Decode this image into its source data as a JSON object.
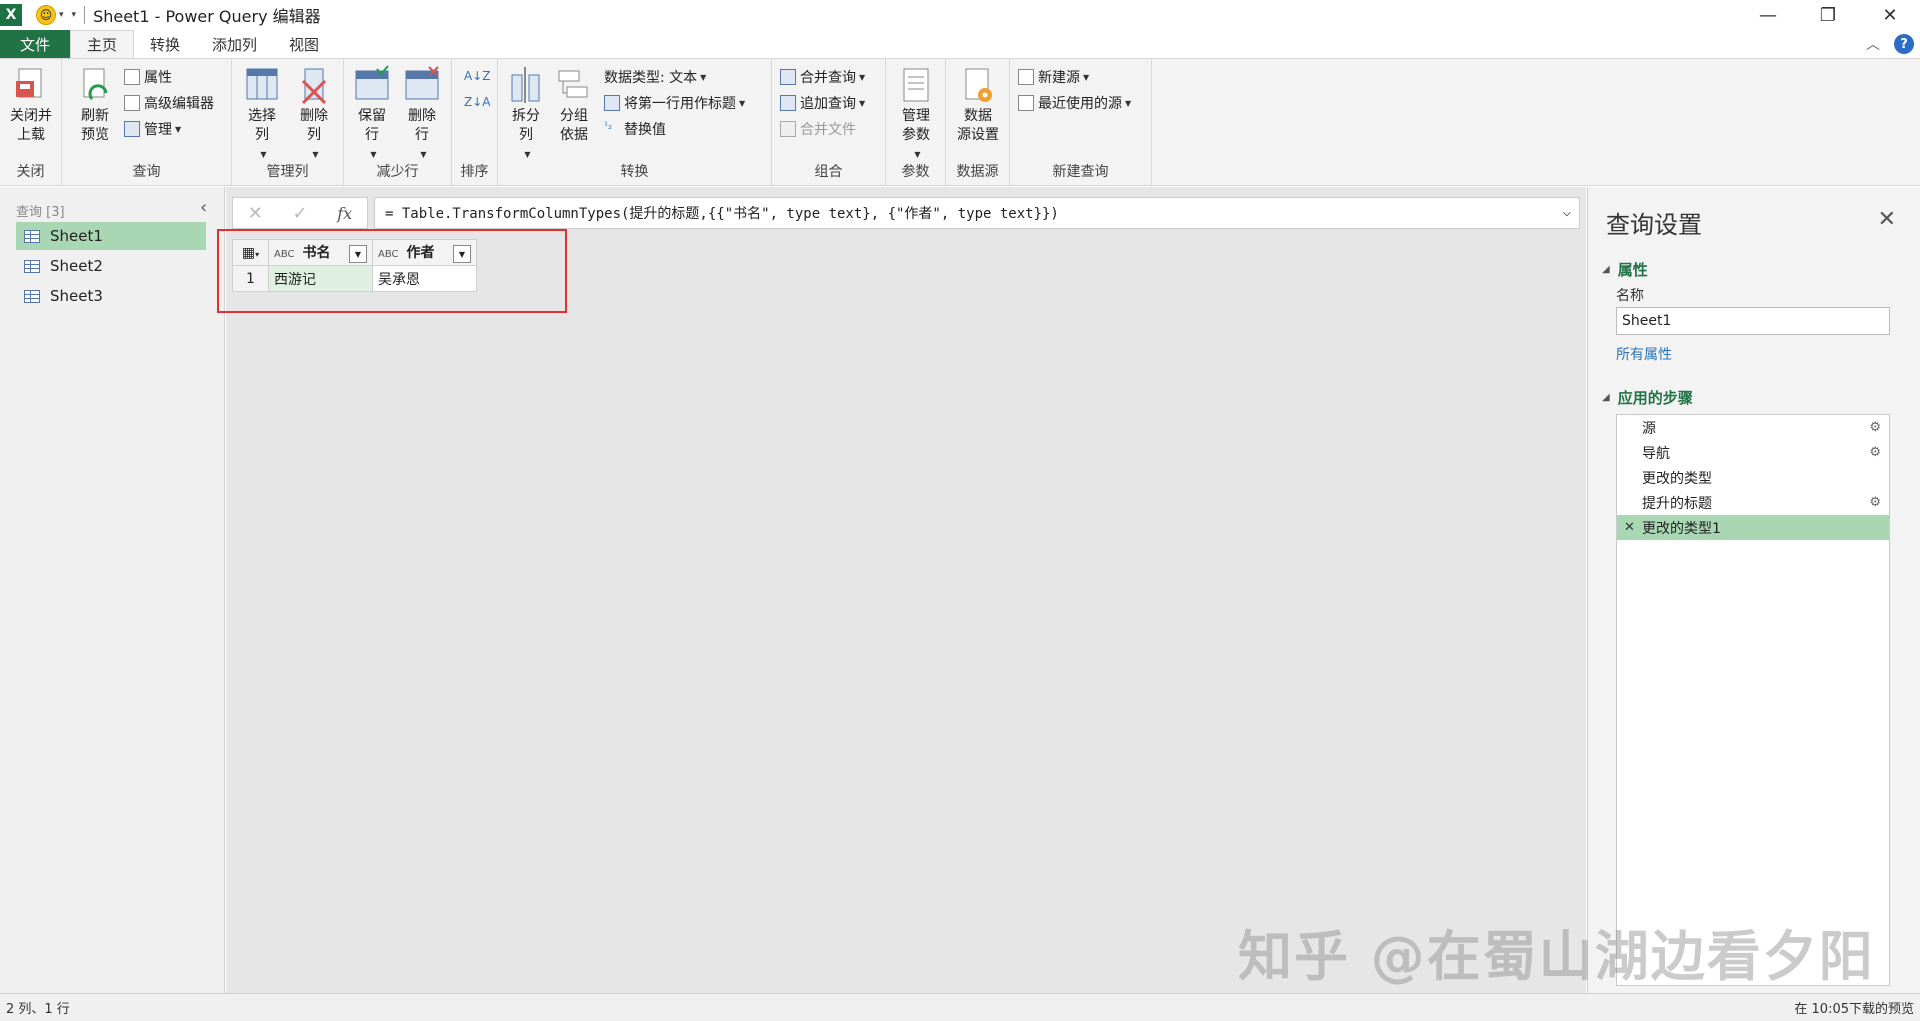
{
  "title": {
    "app_icon": "X",
    "text": "Sheet1 - Power Query 编辑器"
  },
  "tabs": [
    "文件",
    "主页",
    "转换",
    "添加列",
    "视图"
  ],
  "ribbon": {
    "close_load": "关闭并\n上载",
    "close_group": "关闭",
    "refresh": "刷新\n预览",
    "properties": "属性",
    "advanced_editor": "高级编辑器",
    "manage": "管理",
    "query_group": "查询",
    "choose_cols": "选择\n列",
    "remove_cols": "删除\n列",
    "manage_cols_group": "管理列",
    "keep_rows": "保留\n行",
    "remove_rows": "删除\n行",
    "reduce_rows_group": "减少行",
    "sort_group": "排序",
    "split_col": "拆分\n列",
    "group_by": "分组\n依据",
    "data_type": "数据类型: 文本",
    "first_row_header": "将第一行用作标题",
    "replace_values": "替换值",
    "transform_group": "转换",
    "merge_queries": "合并查询",
    "append_queries": "追加查询",
    "combine_files": "合并文件",
    "combine_group": "组合",
    "manage_params": "管理\n参数",
    "params_group": "参数",
    "data_source_settings": "数据\n源设置",
    "data_source_group": "数据源",
    "new_source": "新建源",
    "recent_sources": "最近使用的源",
    "new_query_group": "新建查询"
  },
  "queries": {
    "header": "查询 [3]",
    "items": [
      "Sheet1",
      "Sheet2",
      "Sheet3"
    ]
  },
  "formula": "= Table.TransformColumnTypes(提升的标题,{{\"书名\", type text}, {\"作者\", type text}})",
  "grid": {
    "type_icon": "ABC",
    "columns": [
      "书名",
      "作者"
    ],
    "rows": [
      {
        "num": "1",
        "cells": [
          "西游记",
          "吴承恩"
        ]
      }
    ]
  },
  "settings": {
    "title": "查询设置",
    "properties_label": "属性",
    "name_label": "名称",
    "name_value": "Sheet1",
    "all_properties": "所有属性",
    "applied_steps_label": "应用的步骤",
    "steps": [
      "源",
      "导航",
      "更改的类型",
      "提升的标题",
      "更改的类型1"
    ]
  },
  "status": {
    "left": "2 列、1 行",
    "right": "在 10:05下载的预览"
  },
  "watermark": "知乎 @在蜀山湖边看夕阳",
  "colors": {
    "accent": "#217346",
    "selection": "#a9d7b4",
    "highlight": "#e03030"
  }
}
